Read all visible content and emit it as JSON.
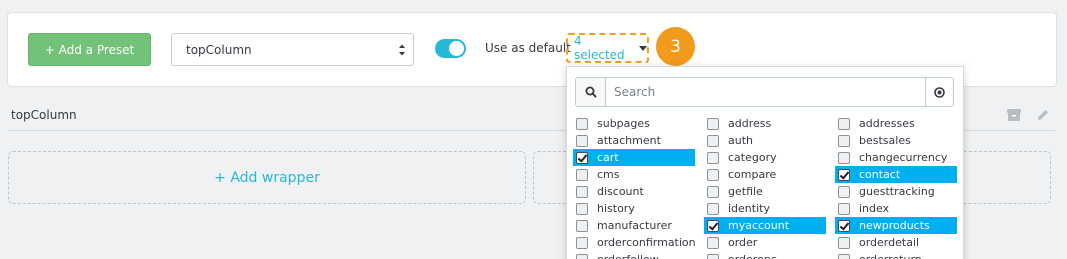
{
  "toolbar": {
    "add_preset_label": "+ Add a Preset",
    "hook_select_value": "topColumn",
    "use_default_label": "Use as default",
    "selected_label": "4 selected",
    "step_number": "3"
  },
  "hook": {
    "title": "topColumn",
    "add_wrapper_label": "+ Add wrapper"
  },
  "dropdown": {
    "search_placeholder": "Search",
    "columns": [
      [
        {
          "label": "subpages",
          "checked": false
        },
        {
          "label": "attachment",
          "checked": false
        },
        {
          "label": "cart",
          "checked": true
        },
        {
          "label": "cms",
          "checked": false
        },
        {
          "label": "discount",
          "checked": false
        },
        {
          "label": "history",
          "checked": false
        },
        {
          "label": "manufacturer",
          "checked": false
        },
        {
          "label": "orderconfirmation",
          "checked": false
        },
        {
          "label": "orderfollow",
          "checked": false
        }
      ],
      [
        {
          "label": "address",
          "checked": false
        },
        {
          "label": "auth",
          "checked": false
        },
        {
          "label": "category",
          "checked": false
        },
        {
          "label": "compare",
          "checked": false
        },
        {
          "label": "getfile",
          "checked": false
        },
        {
          "label": "identity",
          "checked": false
        },
        {
          "label": "myaccount",
          "checked": true
        },
        {
          "label": "order",
          "checked": false
        },
        {
          "label": "orderopc",
          "checked": false
        }
      ],
      [
        {
          "label": "addresses",
          "checked": false
        },
        {
          "label": "bestsales",
          "checked": false
        },
        {
          "label": "changecurrency",
          "checked": false
        },
        {
          "label": "contact",
          "checked": true
        },
        {
          "label": "guesttracking",
          "checked": false
        },
        {
          "label": "index",
          "checked": false
        },
        {
          "label": "newproducts",
          "checked": true
        },
        {
          "label": "orderdetail",
          "checked": false
        },
        {
          "label": "orderreturn",
          "checked": false
        }
      ]
    ]
  },
  "colors": {
    "accent": "#25b9d7",
    "preset_button": "#72c279",
    "highlight": "#f29a1c",
    "selected_row": "#00aff0"
  },
  "icons": [
    "chevron-updown-icon",
    "caret-down-icon",
    "search-icon",
    "clear-icon",
    "archive-icon",
    "pencil-icon"
  ]
}
